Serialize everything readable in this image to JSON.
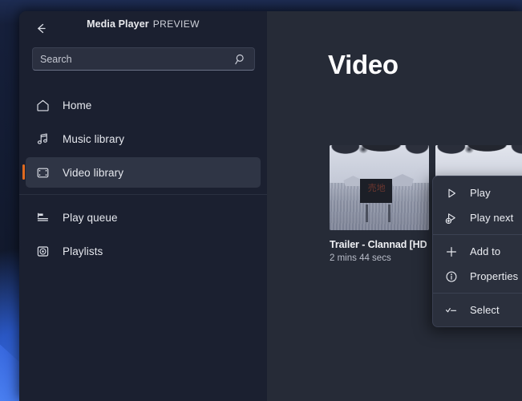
{
  "window": {
    "back_icon": "back-arrow-icon",
    "title": "Media Player",
    "preview_tag": "PREVIEW"
  },
  "search": {
    "placeholder": "Search",
    "value": "",
    "icon": "search-icon"
  },
  "sidebar": {
    "items": [
      {
        "label": "Home",
        "icon": "home-icon",
        "selected": false
      },
      {
        "label": "Music library",
        "icon": "music-note-icon",
        "selected": false
      },
      {
        "label": "Video library",
        "icon": "video-frame-icon",
        "selected": true
      },
      {
        "label": "Play queue",
        "icon": "play-queue-icon",
        "selected": false
      },
      {
        "label": "Playlists",
        "icon": "playlists-disc-icon",
        "selected": false
      }
    ]
  },
  "main": {
    "page_title": "Video",
    "videos": [
      {
        "title": "Trailer - Clannad [HD",
        "duration": "2 mins 44 secs",
        "sign_text": "売地"
      },
      {
        "title": "",
        "duration": "",
        "sign_text": ""
      }
    ]
  },
  "context_menu": {
    "items": [
      {
        "label": "Play",
        "icon": "play-triangle-icon"
      },
      {
        "label": "Play next",
        "icon": "play-next-icon"
      },
      {
        "label": "Add to",
        "icon": "plus-icon"
      },
      {
        "label": "Properties",
        "icon": "info-circle-icon"
      },
      {
        "label": "Select",
        "icon": "check-dash-icon"
      }
    ]
  },
  "colors": {
    "accent": "#e06a1f",
    "sidebar_bg": "#1b2030",
    "main_bg": "#262b37",
    "menu_bg": "#2b303d",
    "selected_bg": "#2f3545",
    "desktop_blue": "#3b6fe0"
  }
}
